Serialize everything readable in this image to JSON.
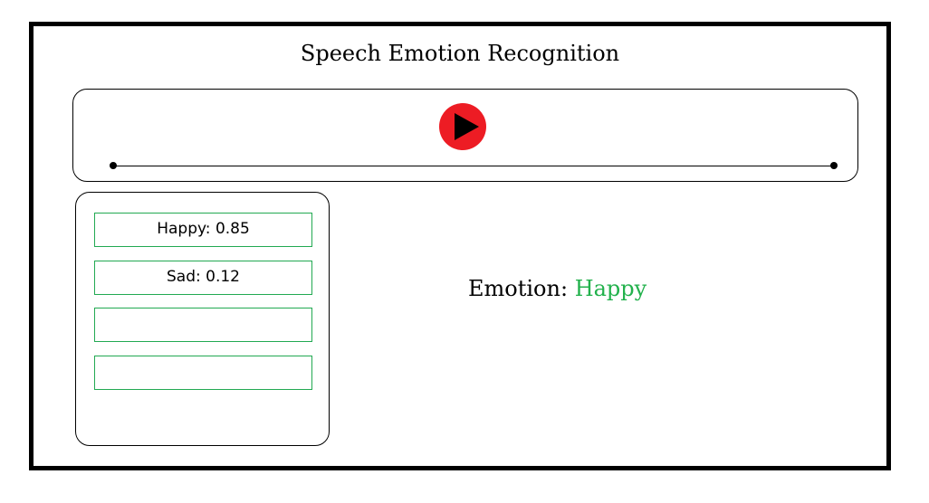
{
  "app": {
    "title": "Speech Emotion Recognition"
  },
  "player": {
    "play_icon": "play-icon",
    "accent_color": "#ed1c24"
  },
  "results": [
    {
      "label": "Happy: 0.85"
    },
    {
      "label": "Sad: 0.12"
    },
    {
      "label": ""
    },
    {
      "label": ""
    }
  ],
  "emotion": {
    "label": "Emotion:",
    "value": "Happy",
    "value_color": "#22b14c"
  },
  "colors": {
    "border": "#000000",
    "result_border": "#22a952"
  }
}
